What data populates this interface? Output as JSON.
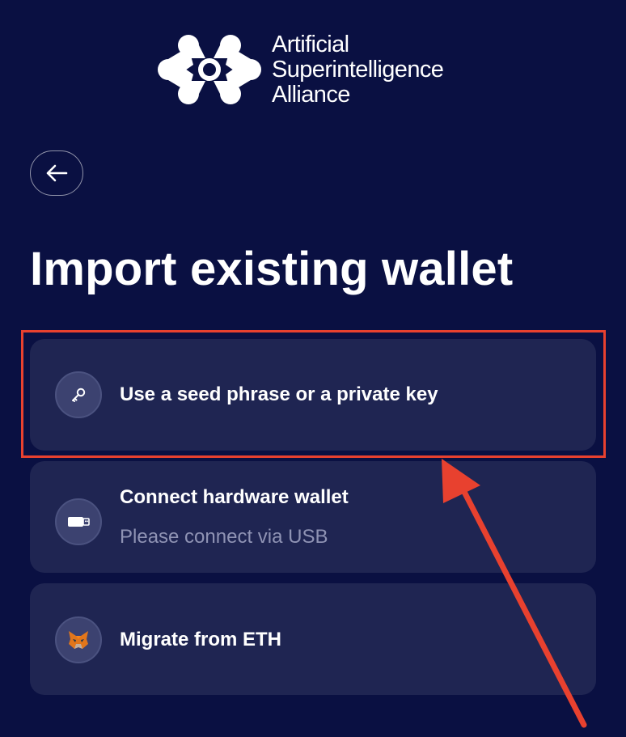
{
  "brand": {
    "line1": "Artificial",
    "line2": "Superintelligence",
    "line3": "Alliance"
  },
  "header": {
    "back_icon": "arrow-left-icon"
  },
  "page": {
    "title": "Import existing wallet"
  },
  "options": [
    {
      "label": "Use a seed phrase or a private key",
      "icon": "key-icon"
    },
    {
      "label": "Connect hardware wallet",
      "sublabel": "Please connect via USB",
      "icon": "usb-icon"
    },
    {
      "label": "Migrate from ETH",
      "icon": "metamask-fox-icon"
    }
  ],
  "colors": {
    "background": "#0a1042",
    "card": "#1f2552",
    "icon_circle": "#3c4270",
    "muted_text": "#8f93b4",
    "annotation": "#e8412f"
  }
}
